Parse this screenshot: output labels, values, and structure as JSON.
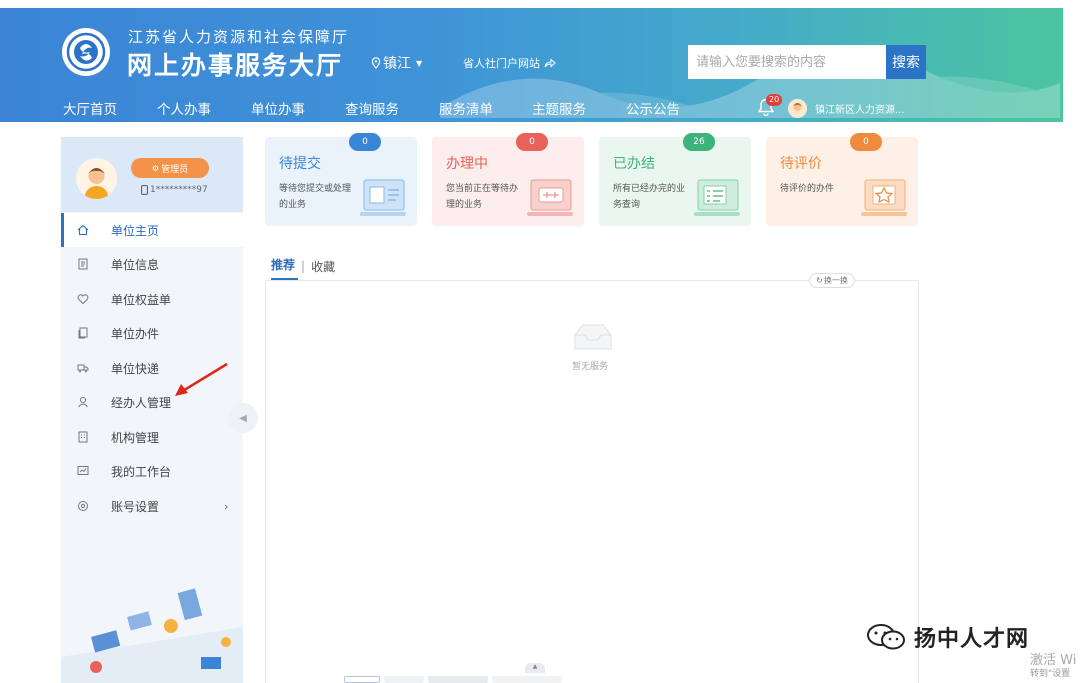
{
  "header": {
    "org_name": "江苏省人力资源和社会保障厅",
    "site_name": "网上办事服务大厅",
    "location": "镇江",
    "portal_link": "省人社门户网站",
    "search_placeholder": "请输入您要搜索的内容",
    "search_button": "搜索",
    "nav": [
      "大厅首页",
      "个人办事",
      "单位办事",
      "查询服务",
      "服务清单",
      "主题服务",
      "公示公告"
    ],
    "notification_count": "20",
    "user_name": "镇江新区人力资源..."
  },
  "sidebar": {
    "role": "管理员",
    "phone": "1*********97",
    "menu": [
      {
        "label": "单位主页",
        "icon": "home-icon"
      },
      {
        "label": "单位信息",
        "icon": "document-icon"
      },
      {
        "label": "单位权益单",
        "icon": "heart-icon"
      },
      {
        "label": "单位办件",
        "icon": "files-icon"
      },
      {
        "label": "单位快递",
        "icon": "truck-icon"
      },
      {
        "label": "经办人管理",
        "icon": "person-icon"
      },
      {
        "label": "机构管理",
        "icon": "building-icon"
      },
      {
        "label": "我的工作台",
        "icon": "monitor-icon"
      },
      {
        "label": "账号设置",
        "icon": "settings-icon"
      }
    ]
  },
  "cards": [
    {
      "title": "待提交",
      "desc": "等待您提交或处理的业务",
      "count": "0",
      "color": "#3a86d6",
      "bg": "#eaf3fc"
    },
    {
      "title": "办理中",
      "desc": "您当前正在等待办理的业务",
      "count": "0",
      "color": "#e8625a",
      "bg": "#fdeeee"
    },
    {
      "title": "已办结",
      "desc": "所有已经办完的业务查询",
      "count": "26",
      "color": "#3cb37a",
      "bg": "#eaf7f0"
    },
    {
      "title": "待评价",
      "desc": "待评价的办件",
      "count": "0",
      "color": "#f08a3c",
      "bg": "#fdf1e7"
    }
  ],
  "tabs": {
    "recommend": "推荐",
    "favorite": "收藏"
  },
  "content": {
    "refresh": "换一换",
    "empty": "暂无服务"
  },
  "watermark": {
    "text": "扬中人才网",
    "win_line1": "激活 Wi",
    "win_line2": "转到\"设置"
  }
}
